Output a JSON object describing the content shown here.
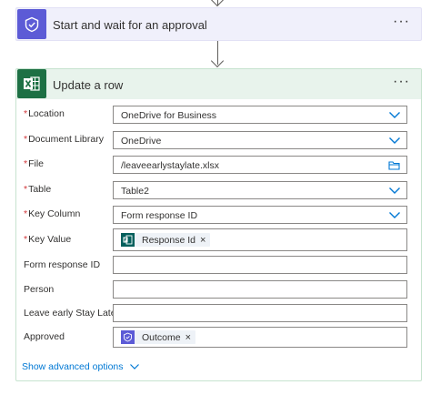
{
  "approval_step": {
    "title": "Start and wait for an approval",
    "more_label": "···",
    "icon": "approval-icon"
  },
  "update_step": {
    "title": "Update a row",
    "more_label": "···",
    "icon": "excel-icon"
  },
  "fields": {
    "location": {
      "label": "Location",
      "required_mark": "*",
      "value": "OneDrive for Business"
    },
    "library": {
      "label": "Document Library",
      "required_mark": "*",
      "value": "OneDrive"
    },
    "file": {
      "label": "File",
      "required_mark": "*",
      "value": "/leaveearlystaylate.xlsx"
    },
    "table": {
      "label": "Table",
      "required_mark": "*",
      "value": "Table2"
    },
    "key_column": {
      "label": "Key Column",
      "required_mark": "*",
      "value": "Form response ID"
    },
    "key_value": {
      "label": "Key Value",
      "required_mark": "*",
      "token": "Response Id",
      "token_remove": "×"
    },
    "form_response_id": {
      "label": "Form response ID",
      "value": ""
    },
    "person": {
      "label": "Person",
      "value": ""
    },
    "leave_early": {
      "label": "Leave early Stay Late",
      "value": ""
    },
    "approved": {
      "label": "Approved",
      "token": "Outcome",
      "token_remove": "×"
    }
  },
  "show_advanced": {
    "label": "Show advanced options"
  },
  "colors": {
    "approval_accent": "#5c5bd6",
    "excel_green": "#1d7044",
    "link_blue": "#0078d4",
    "required_red": "#d13438"
  }
}
